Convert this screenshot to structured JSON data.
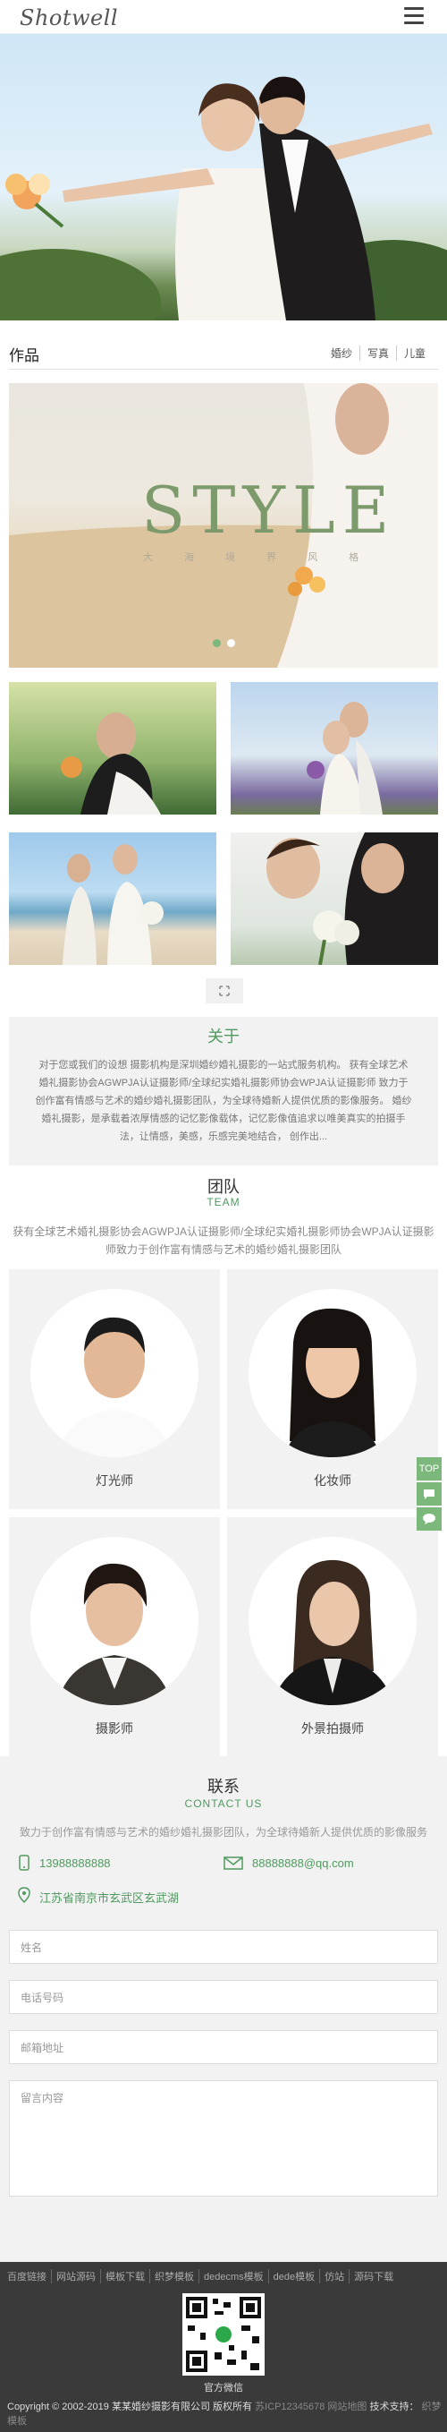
{
  "header": {
    "logo": "Shotwell"
  },
  "works": {
    "title": "作品",
    "tabs": [
      "婚纱",
      "写真",
      "儿童"
    ],
    "banner_title": "STYLE",
    "banner_subtitle": "大 海 境 界 风 格"
  },
  "about": {
    "title": "关于",
    "text": "对于您或我们的设想 摄影机构是深圳婚纱婚礼摄影的一站式服务机构。 获有全球艺术婚礼摄影协会AGWPJA认证摄影师/全球纪实婚礼摄影师协会WPJA认证摄影师 致力于创作富有情感与艺术的婚纱婚礼摄影团队，为全球待婚新人提供优质的影像服务。 婚纱婚礼摄影，是承载着浓厚情感的记忆影像载体，记忆影像值追求以唯美真实的拍摄手法，让情感，美感，乐感完美地结合， 创作出..."
  },
  "team": {
    "title": "团队",
    "subtitle": "TEAM",
    "description": "获有全球艺术婚礼摄影协会AGWPJA认证摄影师/全球纪实婚礼摄影师协会WPJA认证摄影师致力于创作富有情感与艺术的婚纱婚礼摄影团队",
    "members": [
      "灯光师",
      "化妆师",
      "摄影师",
      "外景拍摄师"
    ]
  },
  "side_buttons": {
    "top": "TOP"
  },
  "contact": {
    "title": "联系",
    "subtitle": "CONTACT US",
    "description": "致力于创作富有情感与艺术的婚纱婚礼摄影团队，为全球待婚新人提供优质的影像服务",
    "phone": "13988888888",
    "email": "88888888@qq.com",
    "address": "江苏省南京市玄武区玄武湖",
    "placeholders": {
      "name": "姓名",
      "phone": "电话号码",
      "email": "邮箱地址",
      "message": "留言内容"
    }
  },
  "footer": {
    "links": [
      "百度链接",
      "网站源码",
      "模板下载",
      "织梦模板",
      "dedecms模板",
      "dede模板",
      "仿站",
      "源码下载"
    ],
    "qr_label": "官方微信",
    "copyright": "Copyright © 2002-2019 某某婚纱摄影有限公司 版权所有",
    "icp": "苏ICP12345678",
    "sitemap": "网站地图",
    "tech_support_label": "技术支持：",
    "tech_support_value": "织梦模板"
  },
  "colors": {
    "accent": "#4f9a5f",
    "side_button": "#7cb87c",
    "footer_bg": "#3a3a3a"
  }
}
